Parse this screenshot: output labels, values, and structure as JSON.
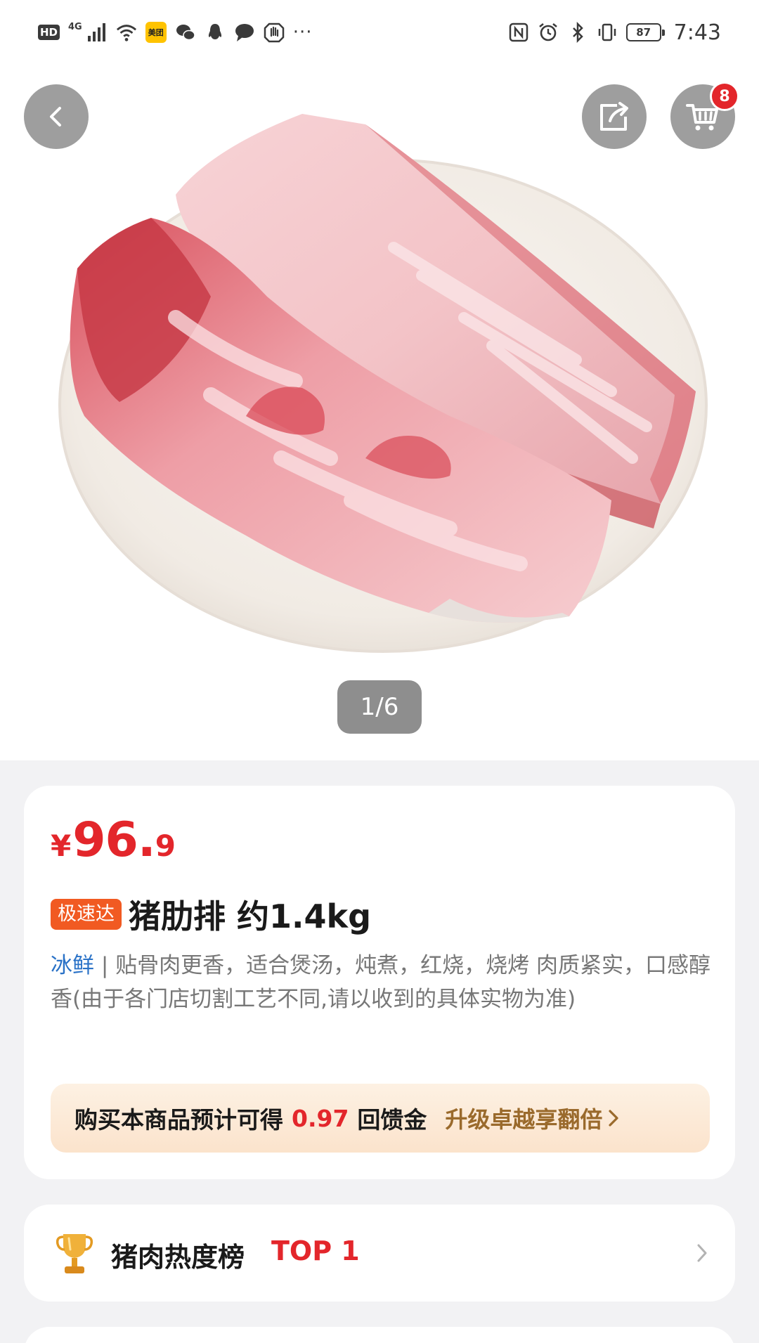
{
  "status_bar": {
    "hd": "HD",
    "network": "4G",
    "meituan_badge": "美团",
    "more": "···",
    "battery": "87",
    "time": "7:43",
    "icons": [
      "signal-icon",
      "wifi-icon",
      "meituan-icon",
      "wechat-icon",
      "qq-icon",
      "message-icon",
      "hand-icon",
      "nfc-icon",
      "alarm-icon",
      "bluetooth-icon",
      "vibrate-icon",
      "battery-icon"
    ]
  },
  "header": {
    "cart_count": "8",
    "icons": [
      "back-icon",
      "share-icon",
      "cart-icon"
    ]
  },
  "gallery": {
    "indicator": "1/6"
  },
  "product": {
    "price_currency": "¥",
    "price_int": "96.",
    "price_dec": "9",
    "tag": "极速达",
    "title": "猪肋排 约1.4kg",
    "desc_tag": "冰鲜",
    "desc_sep": " | ",
    "desc": "贴骨肉更香，适合煲汤，炖煮，红烧，烧烤 肉质紧实，口感醇香(由于各门店切割工艺不同,请以收到的具体实物为准)"
  },
  "rebate": {
    "prefix": "购买本商品预计可得",
    "amount": "0.97",
    "suffix": "回馈金",
    "upgrade": "升级卓越享翻倍"
  },
  "ranking": {
    "label": "猪肉热度榜",
    "value": "TOP 1"
  },
  "colors": {
    "price_red": "#e3262b",
    "fast_tag": "#f15a22",
    "fresh_blue": "#2a72c7",
    "upgrade_gold": "#9a6a2c",
    "page_bg": "#f2f2f4"
  }
}
